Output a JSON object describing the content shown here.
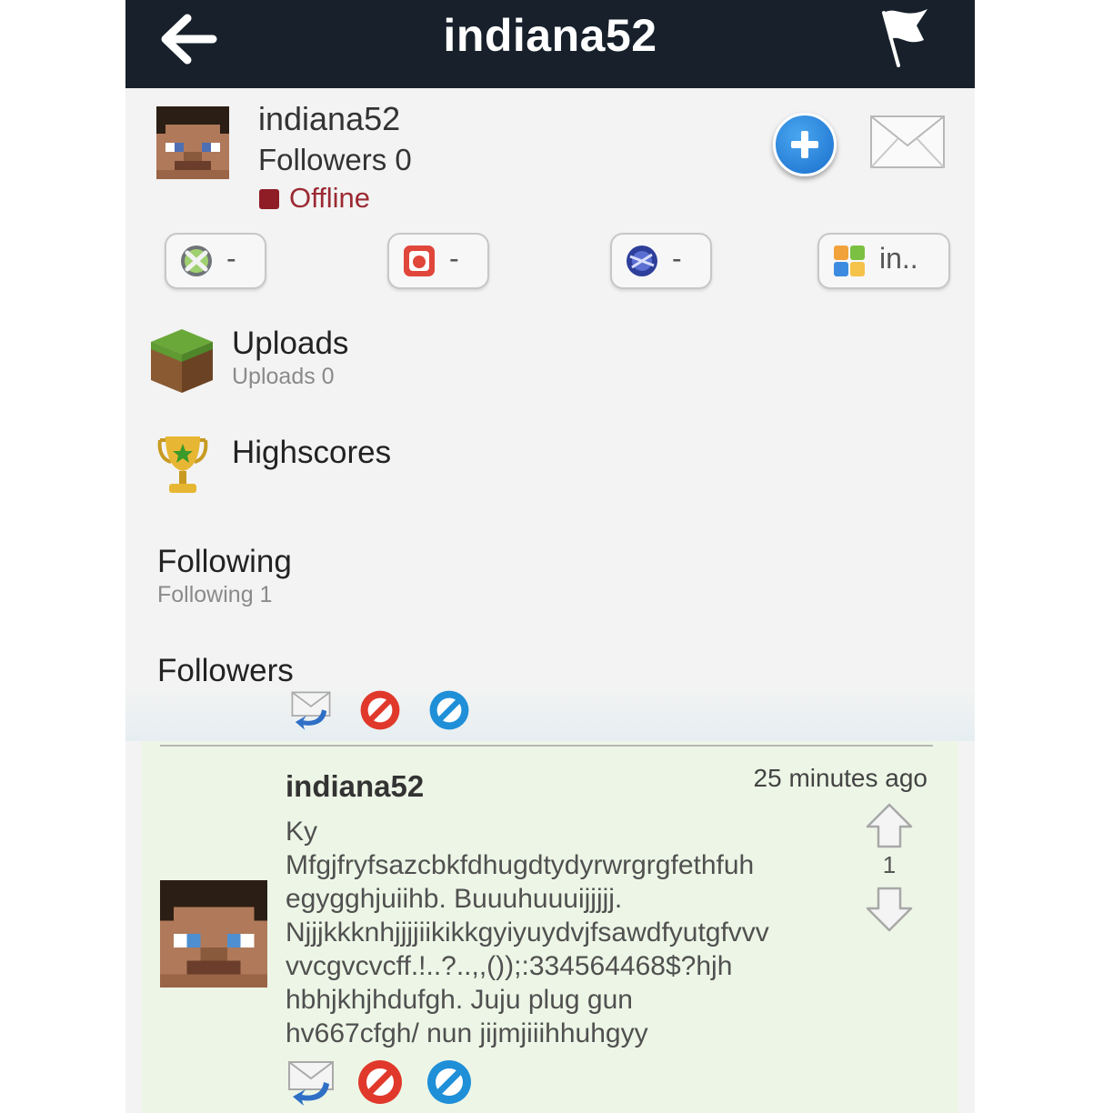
{
  "header": {
    "title": "indiana52"
  },
  "profile": {
    "username": "indiana52",
    "followers_text": "Followers 0",
    "status": "Offline",
    "status_color": "#8e1d25"
  },
  "platforms": [
    {
      "icon": "xbox-icon",
      "value": "-"
    },
    {
      "icon": "gamecenter-app-icon",
      "value": "-"
    },
    {
      "icon": "playstation-icon",
      "value": "-"
    },
    {
      "icon": "game-center-icon",
      "value": "in.."
    }
  ],
  "menu": {
    "uploads": {
      "title": "Uploads",
      "sub": "Uploads 0"
    },
    "highscores": {
      "title": "Highscores"
    },
    "following": {
      "title": "Following",
      "sub": "Following 1"
    },
    "followers": {
      "title": "Followers"
    }
  },
  "comment": {
    "username": "indiana52",
    "time": "25 minutes ago",
    "text": "Ky\nMfgjfryfsazcbkfdhugdtydyrwrgrgfethfuh\negygghjuiihb.  Buuuhuuuijjjjj.\nNjjjkkknhjjjjiikikkgyiyuydvjfsawdfyutgfvvv\nvvcgvcvcff.!..?..,,());:334564468$?hjh\nhbhjkhjhdufgh.  Juju plug gun\nhv667cfgh/ nun jijmjiiihhuhgyy",
    "votes": "1"
  },
  "colors": {
    "nav_bg": "#17202b",
    "comment_bg": "#edf6e6",
    "accent_blue": "#1a6fcc",
    "offline_red": "#9c2a33"
  }
}
